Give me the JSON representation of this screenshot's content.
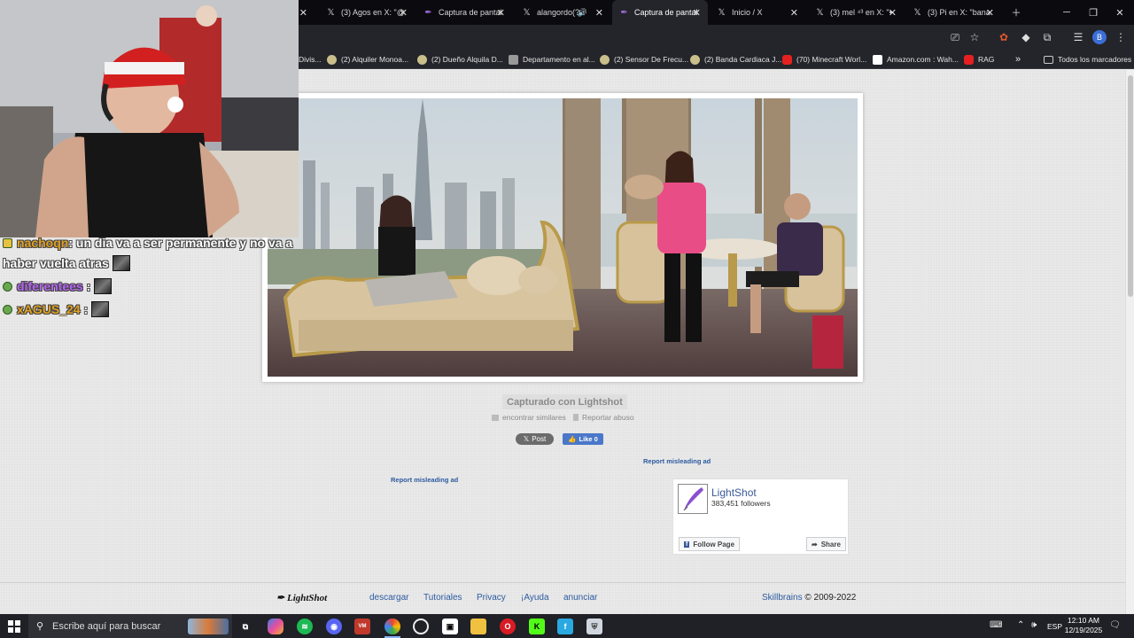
{
  "browser": {
    "tabs": [
      {
        "label": "",
        "icon": "x-icon"
      },
      {
        "label": "(3) Agos en X: \"@",
        "icon": "x-icon"
      },
      {
        "label": "Captura de pantal",
        "icon": "feather-icon"
      },
      {
        "label": "alangordo(? •",
        "icon": "x-icon"
      },
      {
        "label": "Captura de pantal",
        "icon": "feather-icon",
        "active": true
      },
      {
        "label": "Inicio / X",
        "icon": "x-icon"
      },
      {
        "label": "(3) mel ⁴³ en X: \"•",
        "icon": "x-icon"
      },
      {
        "label": "(3) Pi en X: \"bana",
        "icon": "x-icon"
      }
    ],
    "bookmarks": [
      {
        "label": "Divis...",
        "icon": "none"
      },
      {
        "label": "(2) Alquiler Monoa...",
        "icon": "bookmark-icon"
      },
      {
        "label": "(2) Dueño Alquila D...",
        "icon": "bookmark-icon"
      },
      {
        "label": "Departamento en al...",
        "icon": "house-icon"
      },
      {
        "label": "(2) Sensor De Frecu...",
        "icon": "bookmark-icon"
      },
      {
        "label": "(2) Banda Cardiaca J...",
        "icon": "bookmark-icon"
      },
      {
        "label": "(70) Minecraft Worl...",
        "icon": "youtube-icon"
      },
      {
        "label": "Amazon.com : Wah...",
        "icon": "amazon-icon"
      },
      {
        "label": "RAG",
        "icon": "youtube-icon"
      }
    ],
    "more_bookmarks": "»",
    "all_bookmarks": "Todos los marcadores"
  },
  "page": {
    "captured_label": "Capturado con Lightshot",
    "find_similar": "encontrar similares",
    "report_abuse": "Reportar abuso",
    "post_label": "Post",
    "like_label": "Like 0",
    "report_ad_1": "Report misleading ad",
    "report_ad_2": "Report misleading ad",
    "fb": {
      "name": "LightShot",
      "followers": "383,451 followers",
      "follow": "Follow Page",
      "share": "Share"
    },
    "footer": {
      "logo": "LightShot",
      "links": [
        "descargar",
        "Tutoriales",
        "Privacy",
        "¡Ayuda",
        "anunciar"
      ],
      "company": "Skillbrains",
      "copyright": " © 2009-2022"
    }
  },
  "chat": [
    {
      "user": "nachoqn",
      "message": ": un dia va a ser permanente y no va a",
      "badge": "yellow"
    },
    {
      "user": "",
      "message": "haber vuelta atras",
      "badge": "none"
    },
    {
      "user": "diferentees",
      "message": " :",
      "badge": "green"
    },
    {
      "user": "xAGUS_24",
      "message": " :",
      "badge": "green"
    }
  ],
  "taskbar": {
    "search_placeholder": "Escribe aquí para buscar",
    "language": "ESP",
    "time": "12:10 AM",
    "date": "12/19/2025"
  },
  "colors": {
    "chrome_bg": "#24242b",
    "link": "#2c5aa0",
    "chat_user": "#b464f0",
    "chat_user_gold": "#e0a020"
  }
}
